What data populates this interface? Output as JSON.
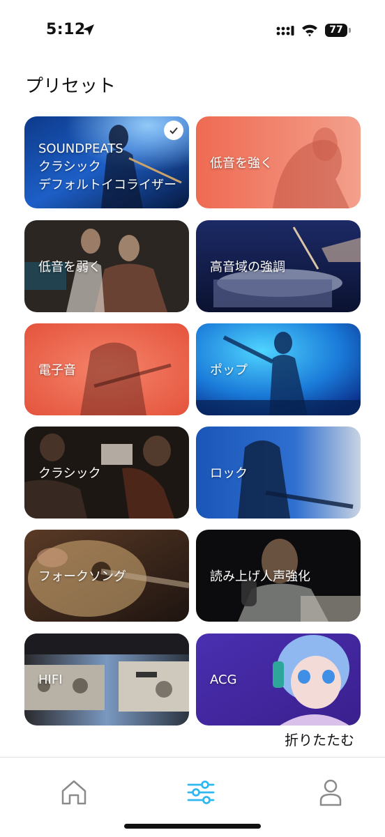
{
  "status_bar": {
    "time": "5:12",
    "battery": "77"
  },
  "page_title": "プリセット",
  "presets": [
    {
      "lines": [
        "SOUNDPEATS",
        "クラシック",
        "デフォルトイコライザー"
      ],
      "selected": true
    },
    {
      "label": "低音を強く"
    },
    {
      "label": "低音を弱く"
    },
    {
      "label": "高音域の強調"
    },
    {
      "label": "電子音"
    },
    {
      "label": "ポップ"
    },
    {
      "label": "クラシック"
    },
    {
      "label": "ロック"
    },
    {
      "label": "フォークソング"
    },
    {
      "label": "読み上げ人声強化"
    },
    {
      "label": "HIFI"
    },
    {
      "label": "ACG"
    }
  ],
  "collapse_label": "折りたたむ",
  "tab_bar": {
    "icons": [
      "home-icon",
      "equalizer-icon",
      "profile-icon"
    ],
    "active_index": 1,
    "accent_color": "#2fb8f0"
  }
}
